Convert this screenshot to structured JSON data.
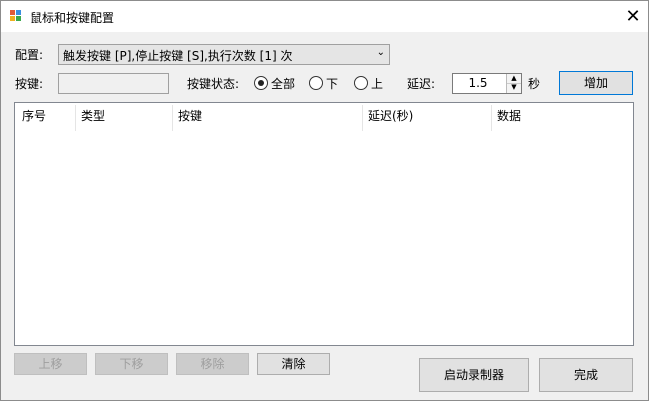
{
  "window": {
    "title": "鼠标和按键配置"
  },
  "config": {
    "label": "配置:",
    "selected": "触发按键 [P],停止按键 [S],执行次数 [1] 次"
  },
  "key": {
    "label": "按键:",
    "value": ""
  },
  "key_state": {
    "label": "按键状态:",
    "options": [
      "全部",
      "下",
      "上"
    ],
    "selected": "全部"
  },
  "delay": {
    "label": "延迟:",
    "value": "1.5",
    "unit": "秒"
  },
  "buttons": {
    "add": "增加",
    "move_up": "上移",
    "move_down": "下移",
    "remove": "移除",
    "clear": "清除",
    "start_recorder": "启动录制器",
    "done": "完成"
  },
  "table": {
    "columns": [
      "序号",
      "类型",
      "按键",
      "延迟(秒)",
      "数据"
    ],
    "rows": []
  }
}
